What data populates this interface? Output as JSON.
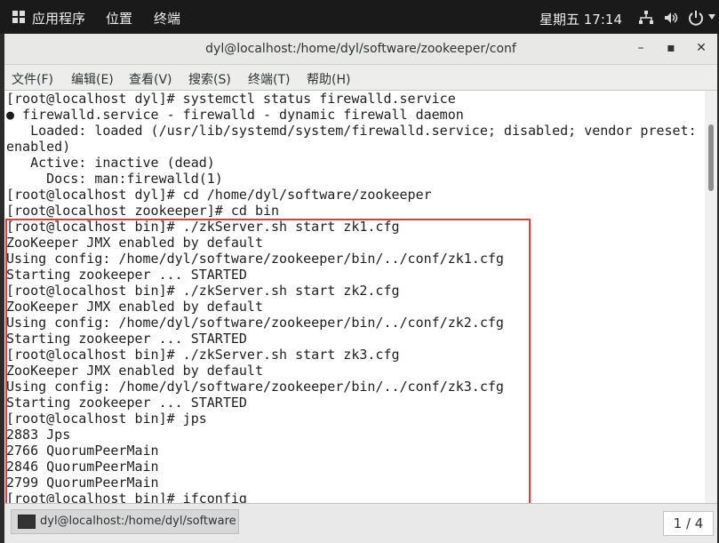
{
  "top_panel": {
    "apps_label": "应用程序",
    "places_label": "位置",
    "terminal_label": "终端",
    "clock": "星期五 17:14"
  },
  "window": {
    "title": "dyl@localhost:/home/dyl/software/zookeeper/conf",
    "minimize": "–",
    "maximize": "▪",
    "close": "✕"
  },
  "menubar": {
    "file": "文件(F)",
    "edit": "编辑(E)",
    "view": "查看(V)",
    "search": "搜索(S)",
    "terminal": "终端(T)",
    "help": "帮助(H)"
  },
  "terminal": {
    "lines": [
      "[root@localhost dyl]# systemctl status firewalld.service",
      "● firewalld.service - firewalld - dynamic firewall daemon",
      "   Loaded: loaded (/usr/lib/systemd/system/firewalld.service; disabled; vendor preset:",
      "enabled)",
      "   Active: inactive (dead)",
      "     Docs: man:firewalld(1)",
      "[root@localhost dyl]# cd /home/dyl/software/zookeeper",
      "[root@localhost zookeeper]# cd bin",
      "[root@localhost bin]# ./zkServer.sh start zk1.cfg",
      "ZooKeeper JMX enabled by default",
      "Using config: /home/dyl/software/zookeeper/bin/../conf/zk1.cfg",
      "Starting zookeeper ... STARTED",
      "[root@localhost bin]# ./zkServer.sh start zk2.cfg",
      "ZooKeeper JMX enabled by default",
      "Using config: /home/dyl/software/zookeeper/bin/../conf/zk2.cfg",
      "Starting zookeeper ... STARTED",
      "[root@localhost bin]# ./zkServer.sh start zk3.cfg",
      "ZooKeeper JMX enabled by default",
      "Using config: /home/dyl/software/zookeeper/bin/../conf/zk3.cfg",
      "Starting zookeeper ... STARTED",
      "[root@localhost bin]# jps",
      "2883 Jps",
      "2766 QuorumPeerMain",
      "2846 QuorumPeerMain",
      "2799 QuorumPeerMain",
      "[root@localhost bin]# ifconfig"
    ]
  },
  "taskbar": {
    "task_label": "dyl@localhost:/home/dyl/software/…",
    "pager": "1 / 4"
  },
  "colors": {
    "highlight_border": "#e53935",
    "panel_bg": "#1a1a1a",
    "terminal_bg": "#ffffff"
  }
}
